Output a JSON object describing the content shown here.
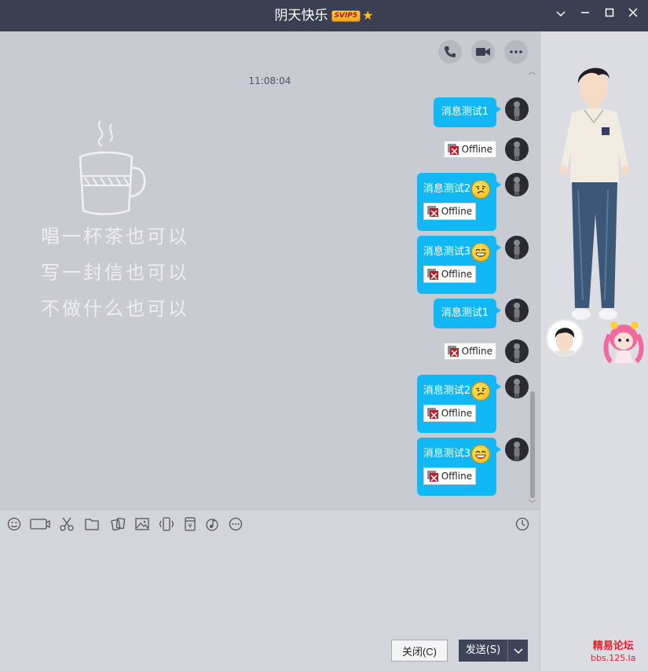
{
  "window": {
    "title": "阴天快乐",
    "badge": "SVIP5",
    "controls": [
      "minimize",
      "maximize",
      "close",
      "dropdown"
    ]
  },
  "chat": {
    "timestamp": "11:08:04",
    "background_lines": [
      "唱一杯茶也可以",
      "写一封信也可以",
      "不做什么也可以"
    ],
    "messages": [
      {
        "text": "消息测试1",
        "emoji": "",
        "image": ""
      },
      {
        "text": "",
        "emoji": "",
        "image": "Offline"
      },
      {
        "text": "消息测试2",
        "emoji": "frown-emoji",
        "image": "Offline"
      },
      {
        "text": "消息测试3",
        "emoji": "grin-emoji",
        "image": "Offline"
      },
      {
        "text": "消息测试1",
        "emoji": "",
        "image": ""
      },
      {
        "text": "",
        "emoji": "",
        "image": "Offline"
      },
      {
        "text": "消息测试2",
        "emoji": "frown-emoji",
        "image": "Offline"
      },
      {
        "text": "消息测试3",
        "emoji": "grin-emoji",
        "image": "Offline"
      }
    ]
  },
  "input": {
    "close_label": "关闭(C)",
    "send_label": "发送(S)"
  },
  "watermark": {
    "line1": "精易论坛",
    "line2": "bbs.125.la"
  },
  "colors": {
    "bubble": "#12b7f5",
    "titlebar": "#3b3f52",
    "send_button": "#3f4559"
  }
}
